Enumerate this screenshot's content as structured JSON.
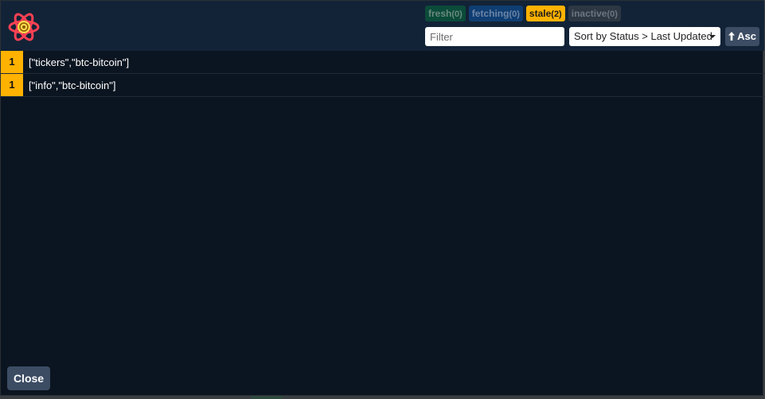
{
  "badges": [
    {
      "label": "fresh",
      "count": "(0)"
    },
    {
      "label": "fetching",
      "count": "(0)"
    },
    {
      "label": "stale",
      "count": "(2)"
    },
    {
      "label": "inactive",
      "count": "(0)"
    }
  ],
  "filter": {
    "placeholder": "Filter",
    "value": ""
  },
  "sort": {
    "selected": "Sort by Status > Last Updated"
  },
  "asc_label": "Asc",
  "queries": [
    {
      "count": "1",
      "key": "[\"tickers\",\"btc-bitcoin\"]"
    },
    {
      "count": "1",
      "key": "[\"info\",\"btc-bitcoin\"]"
    }
  ],
  "close_label": "Close",
  "colors": {
    "stale": "#ffb200",
    "header": "#132337",
    "background": "#0b1521"
  },
  "icons": {
    "logo": "react-query-logo-icon",
    "asc": "arrow-up-icon",
    "sort": "chevron-down-icon"
  }
}
